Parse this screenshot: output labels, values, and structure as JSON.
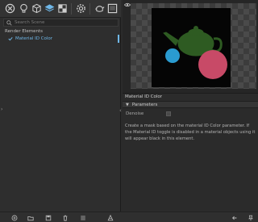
{
  "toolbar": {
    "icons": [
      "render-setup-icon",
      "light-bulb-icon",
      "object-cube-icon",
      "layers-icon",
      "material-icon",
      "settings-gear-icon",
      "teapot-icon",
      "frame-window-icon"
    ]
  },
  "search": {
    "placeholder": "Search Scene"
  },
  "render_elements": {
    "section_label": "Render Elements",
    "items": [
      {
        "label": "Material ID Color",
        "selected": true
      }
    ]
  },
  "properties": {
    "title": "Material ID Color",
    "group_label": "Parameters",
    "denoise_label": "Denoise",
    "denoise_checked": false,
    "description": "Create a mask based on the material ID Color parameter. If the Material ID toggle is disabled in a material objects using it will appear black in this element."
  },
  "colors": {
    "accent": "#6fb7e8",
    "teapot": "#2e5b22",
    "sphere_blue": "#2a9bd0",
    "sphere_pink": "#c84a67"
  },
  "bottom_bar": {
    "icons": [
      "add-element-icon",
      "open-folder-icon",
      "save-icon",
      "delete-icon",
      "list-icon",
      "cone-icon",
      "arrow-left-icon",
      "pin-icon"
    ]
  }
}
